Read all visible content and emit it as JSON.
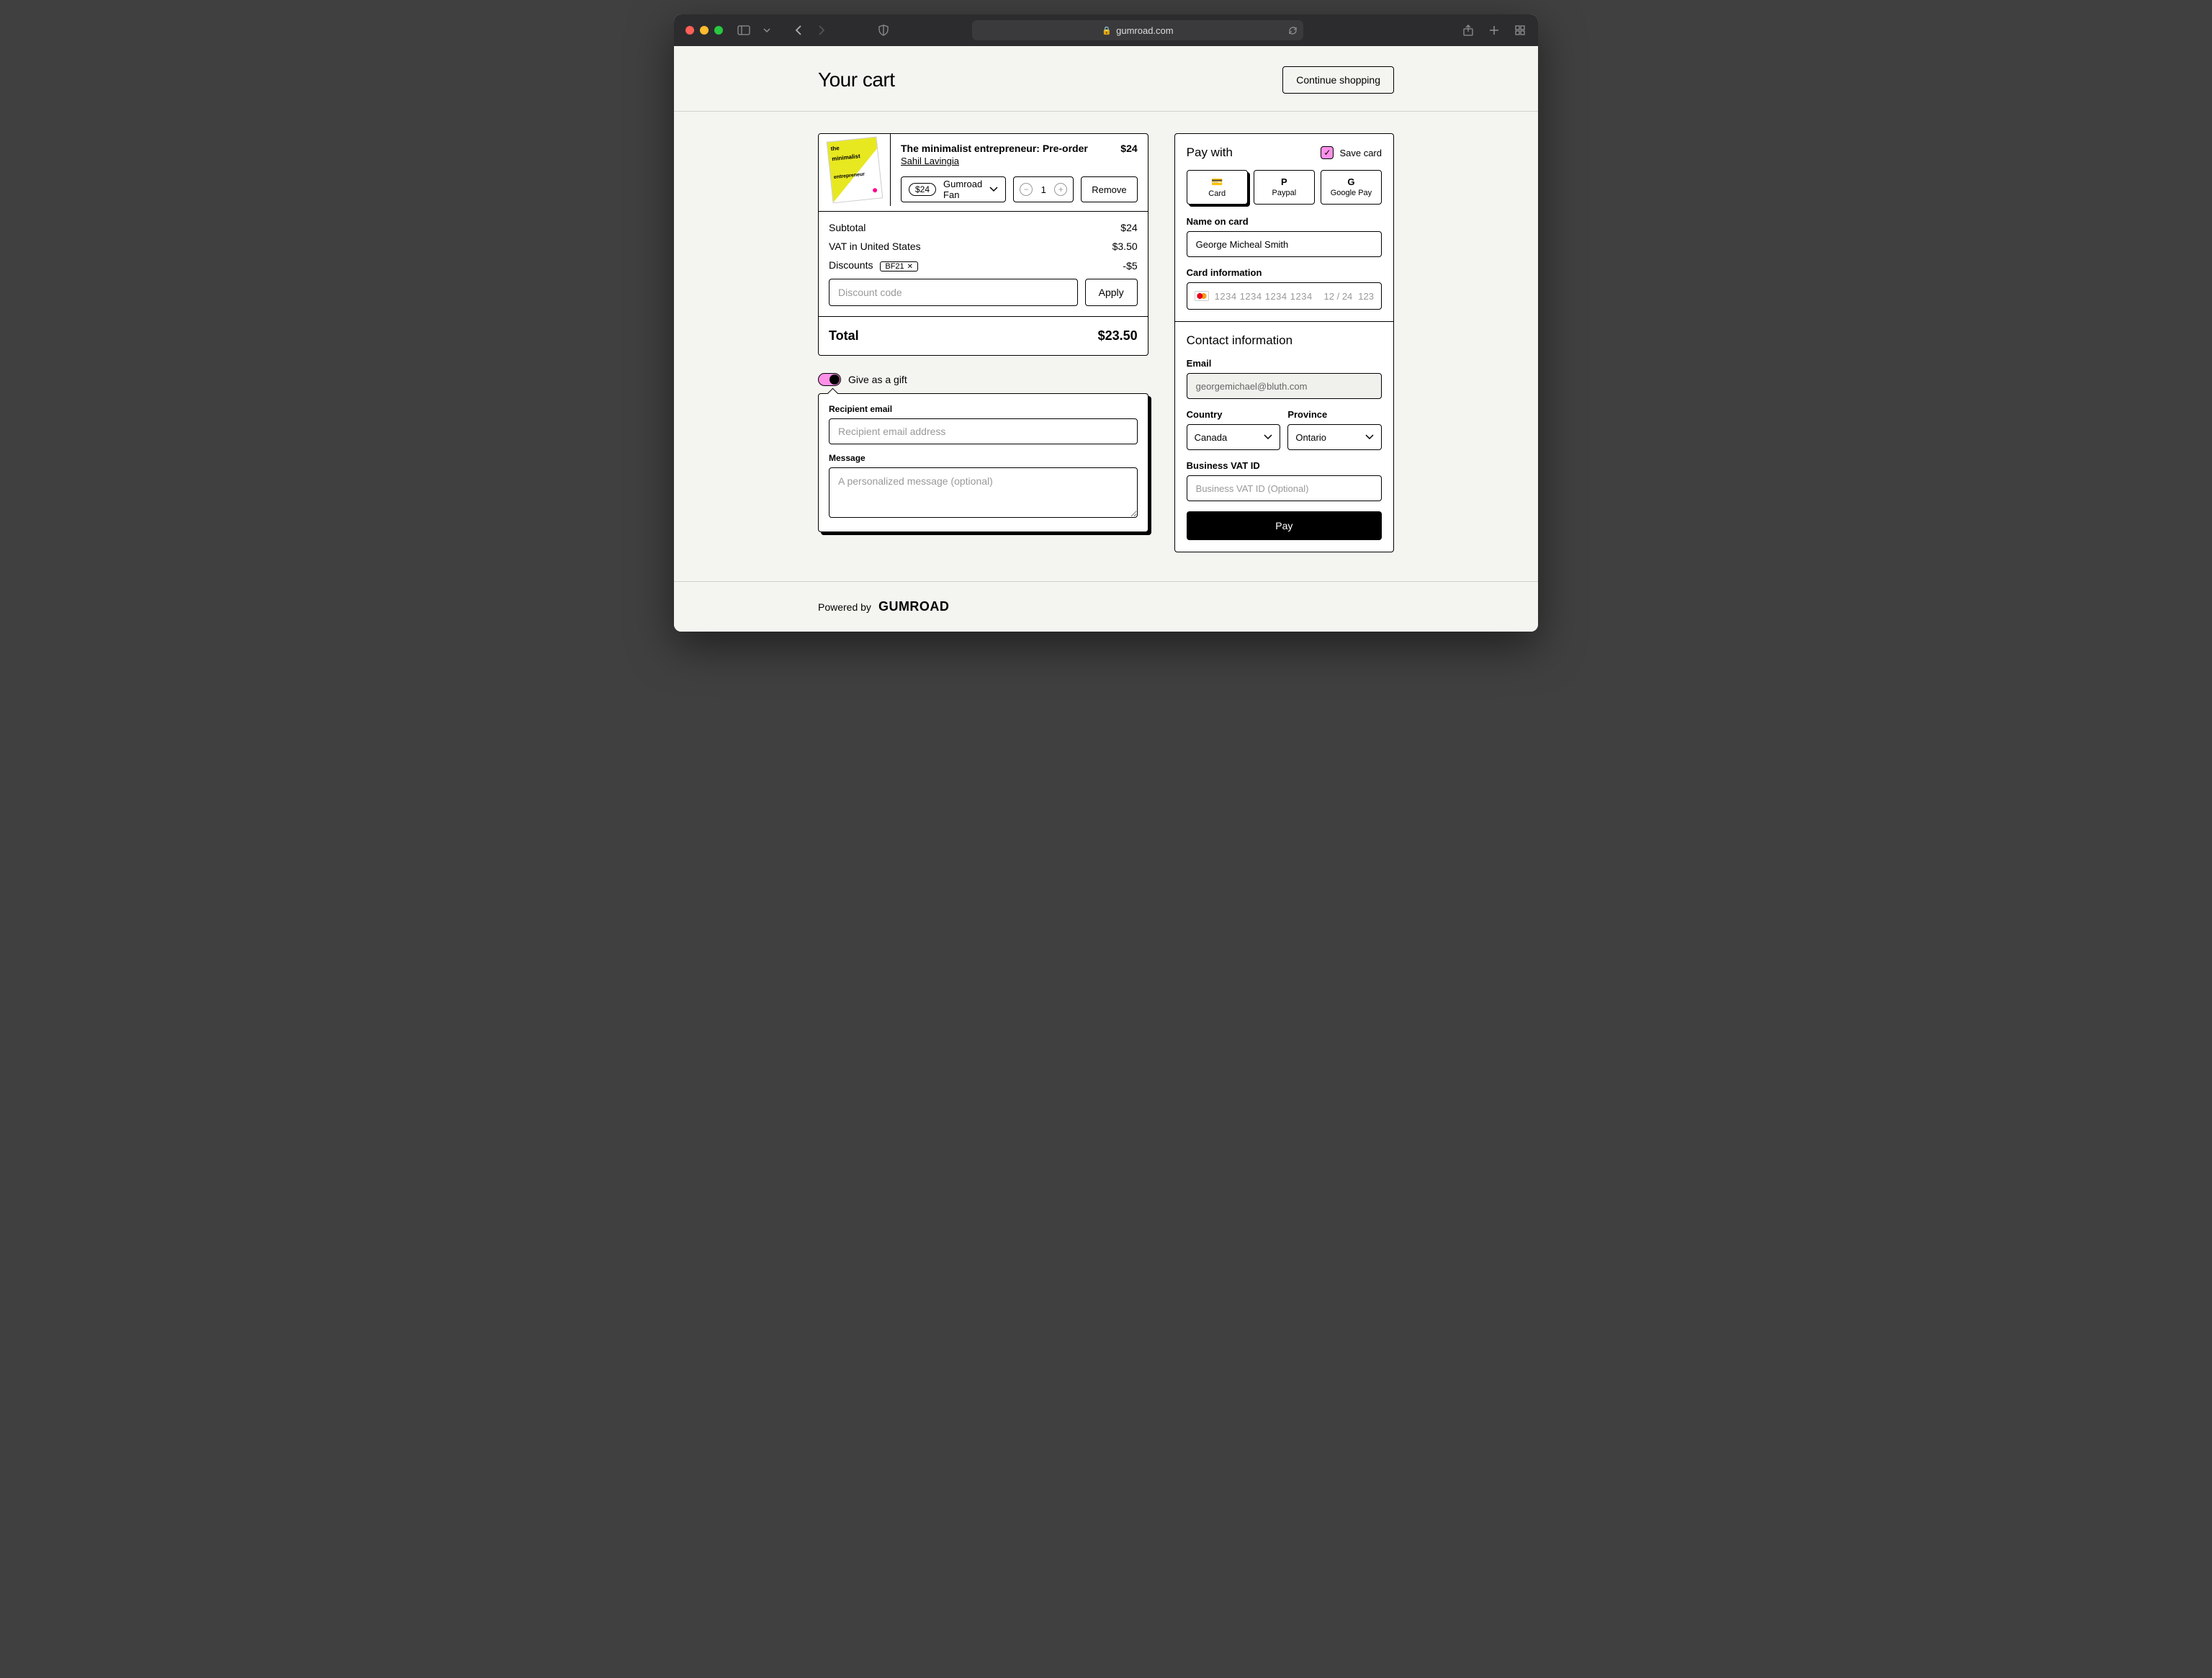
{
  "browser": {
    "url_host": "gumroad.com"
  },
  "header": {
    "title": "Your cart",
    "continue_label": "Continue shopping"
  },
  "cart": {
    "item": {
      "name": "The minimalist entrepreneur: Pre-order",
      "price": "$24",
      "author": "Sahil Lavingia",
      "variant_price": "$24",
      "variant_name": "Gumroad Fan",
      "qty": "1",
      "remove_label": "Remove",
      "thumb_line1": "the",
      "thumb_line2": "minimalist",
      "thumb_line3": "entrepreneur"
    },
    "subtotal_label": "Subtotal",
    "subtotal_value": "$24",
    "vat_label": "VAT in United States",
    "vat_value": "$3.50",
    "discounts_label": "Discounts",
    "discount_code_applied": "BF21",
    "discount_value": "-$5",
    "discount_placeholder": "Discount code",
    "apply_label": "Apply",
    "total_label": "Total",
    "total_value": "$23.50"
  },
  "gift": {
    "toggle_label": "Give as a gift",
    "recipient_label": "Recipient email",
    "recipient_placeholder": "Recipient email address",
    "message_label": "Message",
    "message_placeholder": "A personalized message (optional)"
  },
  "pay": {
    "title": "Pay with",
    "save_card_label": "Save card",
    "methods": {
      "card": "Card",
      "paypal": "Paypal",
      "google": "Google Pay"
    },
    "name_label": "Name on card",
    "name_value": "George Micheal Smith",
    "card_info_label": "Card information",
    "card_number": "1234 1234 1234 1234",
    "card_exp": "12 / 24",
    "card_cvc": "123",
    "contact_title": "Contact information",
    "email_label": "Email",
    "email_value": "georgemichael@bluth.com",
    "country_label": "Country",
    "country_value": "Canada",
    "province_label": "Province",
    "province_value": "Ontario",
    "vat_label": "Business VAT ID",
    "vat_placeholder": "Business VAT ID (Optional)",
    "pay_button": "Pay"
  },
  "footer": {
    "powered": "Powered by",
    "brand": "GUMROAD"
  }
}
